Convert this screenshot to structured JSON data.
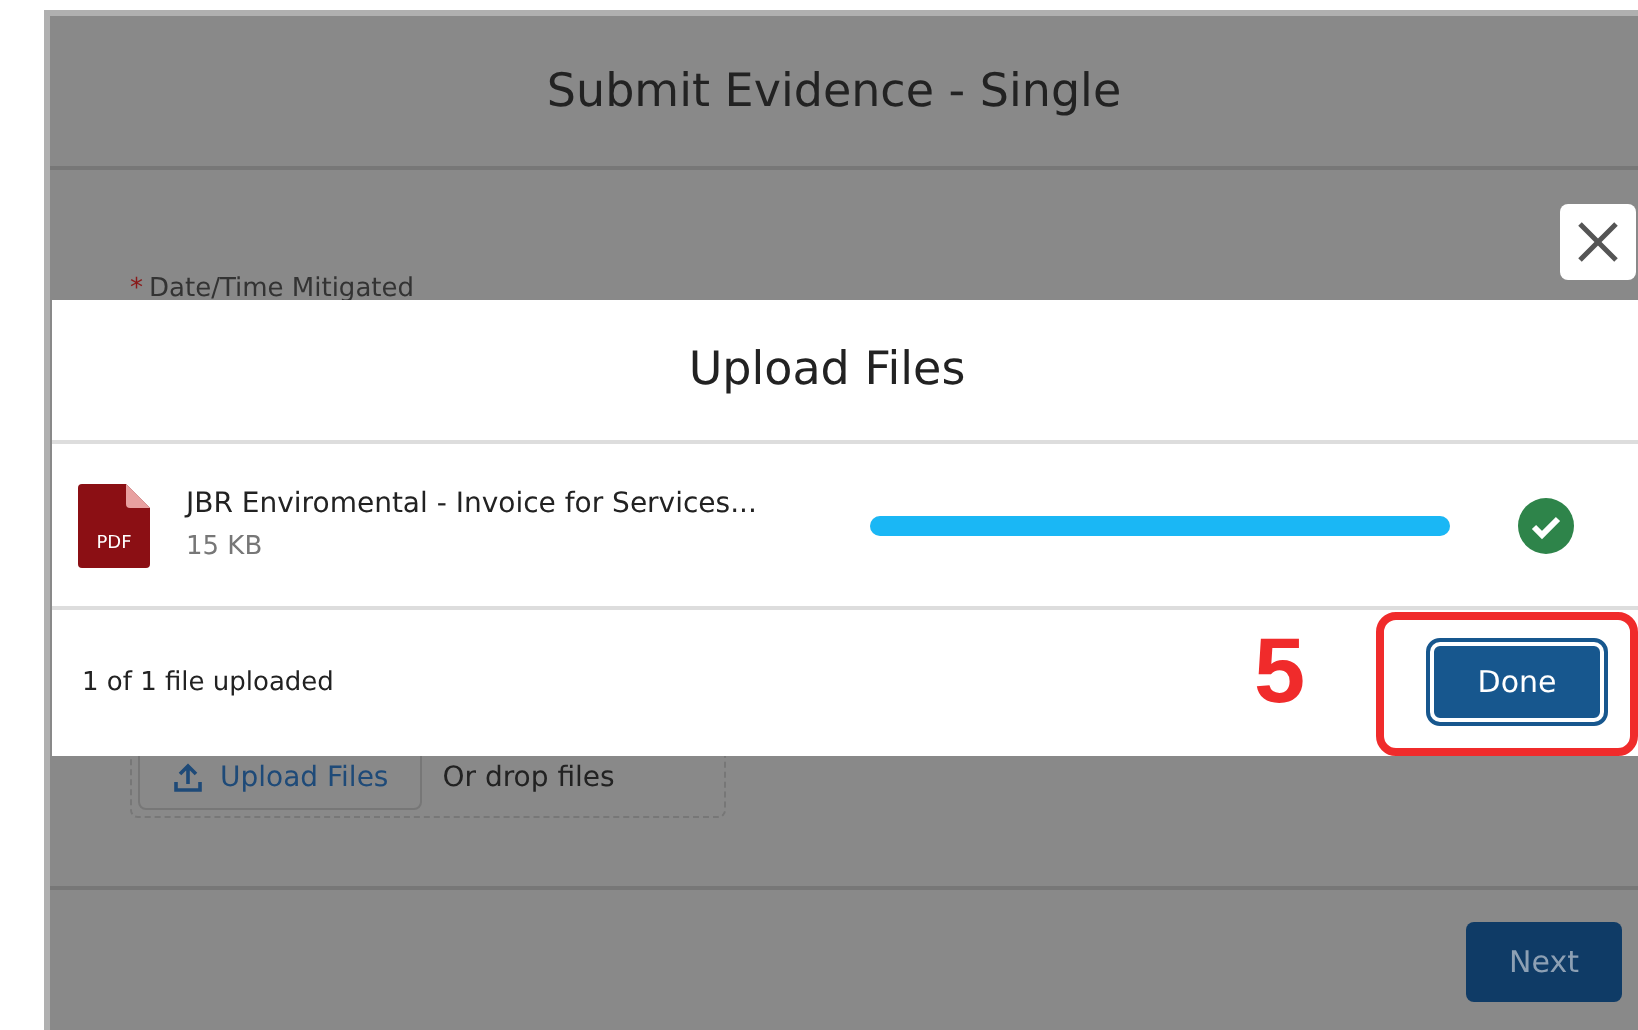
{
  "background_modal": {
    "title": "Submit Evidence - Single",
    "field_label": {
      "text": "Date/Time Mitigated",
      "required_mark": "*"
    },
    "upload_button": "Upload Files",
    "drop_text": "Or drop files",
    "next_button": "Next"
  },
  "upload_dialog": {
    "title": "Upload Files",
    "files": [
      {
        "name": "JBR Enviromental - Invoice for Services...",
        "size": "15 KB",
        "file_type": "PDF",
        "level": 1,
        "complete": true
      }
    ],
    "status": "1 of 1 file uploaded",
    "done_button": "Done"
  },
  "annotation": {
    "step": "5"
  }
}
